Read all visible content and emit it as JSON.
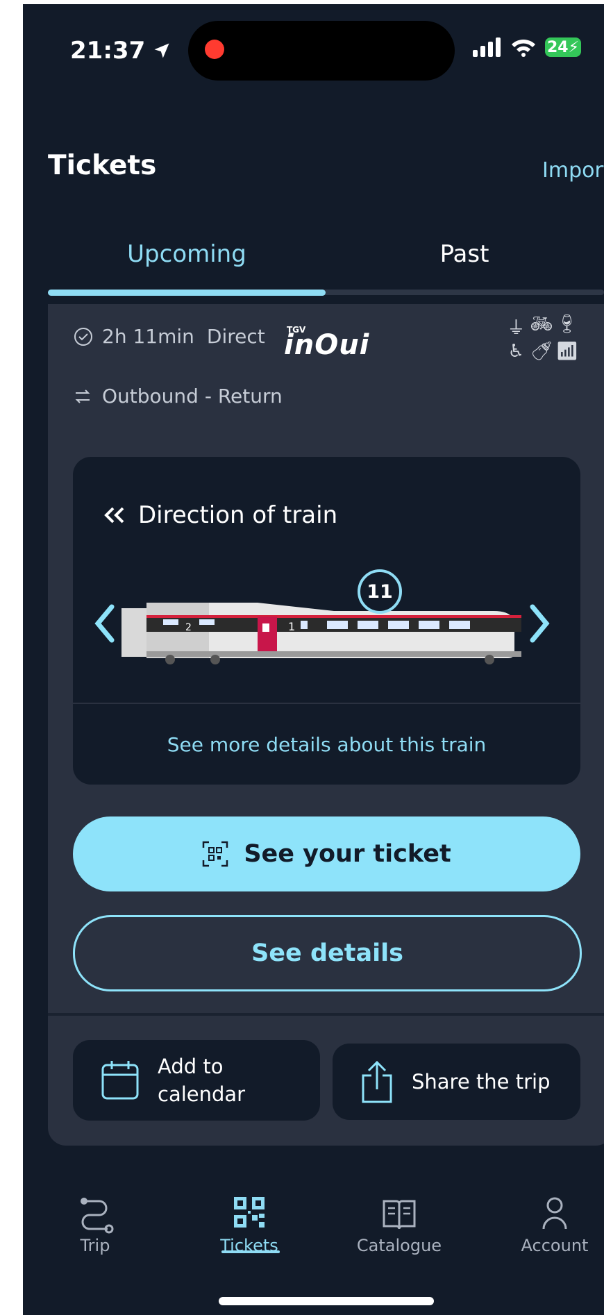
{
  "status_bar": {
    "time": "21:37",
    "battery": "24"
  },
  "header": {
    "title": "Tickets",
    "import_label": "Import"
  },
  "tabs": [
    {
      "label": "Upcoming",
      "active": true
    },
    {
      "label": "Past",
      "active": false
    }
  ],
  "trip": {
    "duration": "2h 11min",
    "type": "Direct",
    "brand_small": "TGV",
    "brand": "inOui",
    "journey": "Outbound - Return",
    "amenities": [
      "plug-icon",
      "bike-icon",
      "bar-icon",
      "wheelchair-icon",
      "bottle-icon",
      "wifi-icon"
    ],
    "train": {
      "direction_label": "Direction of train",
      "car_number": "11",
      "car_class_1": "1",
      "car_class_2": "2",
      "details_link": "See more details about this train"
    },
    "see_ticket_label": "See your ticket",
    "see_details_label": "See details",
    "add_calendar_label": [
      "Add to",
      "calendar"
    ],
    "share_label": "Share the trip"
  },
  "nav": [
    {
      "label": "Trip",
      "icon": "trip-route-icon",
      "active": false
    },
    {
      "label": "Tickets",
      "icon": "qr-code-icon",
      "active": true
    },
    {
      "label": "Catalogue",
      "icon": "catalogue-book-icon",
      "active": false
    },
    {
      "label": "Account",
      "icon": "account-person-icon",
      "active": false
    }
  ],
  "colors": {
    "background": "#121b29",
    "card": "#2a3140",
    "accent": "#8ee3fa",
    "text": "#ffffff"
  }
}
